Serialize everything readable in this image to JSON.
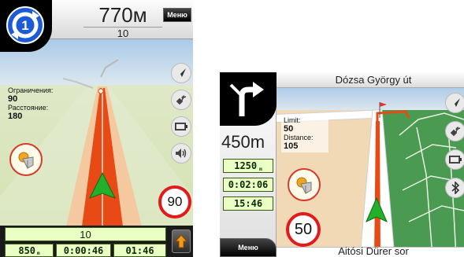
{
  "screen1": {
    "distance": "770м",
    "turn_sub": "10",
    "menu_label": "Меню",
    "limit_label": "Ограничения:",
    "limit_value": "90",
    "distance_label": "Расстояние:",
    "distance_value": "180",
    "speed_sign": "90",
    "bottom_street": "10",
    "bottom_distance": "850",
    "bottom_unit": "m",
    "bottom_time_remaining": "0:00:46",
    "bottom_arrival": "01:46",
    "icons": [
      "roundabout-exit-1-icon",
      "compass-arrow-icon",
      "satellite-icon",
      "battery-icon",
      "speaker-icon",
      "poi-marker-icon",
      "vehicle-arrow-icon",
      "zoom-up-icon"
    ],
    "colors": {
      "route": "#e84a16",
      "vehicle": "#22b02a",
      "info_box": "#e9ffc3",
      "speed_ring": "#e11b1b"
    }
  },
  "screen2": {
    "street_name": "Dózsa György út",
    "distance": "450m",
    "limit_label": "Limit:",
    "limit_value": "50",
    "distance_label": "Distance:",
    "distance_value": "105",
    "box_distance": "1250",
    "box_unit": "m",
    "box_time": "0:02:06",
    "box_arrival": "15:46",
    "speed_sign": "50",
    "menu_label": "Меню",
    "bottom_street": "Aitósi Dürer sor",
    "icons": [
      "turn-right-icon",
      "compass-arrow-icon",
      "satellite-icon",
      "battery-icon",
      "bluetooth-icon",
      "poi-marker-icon",
      "vehicle-arrow-icon"
    ]
  }
}
